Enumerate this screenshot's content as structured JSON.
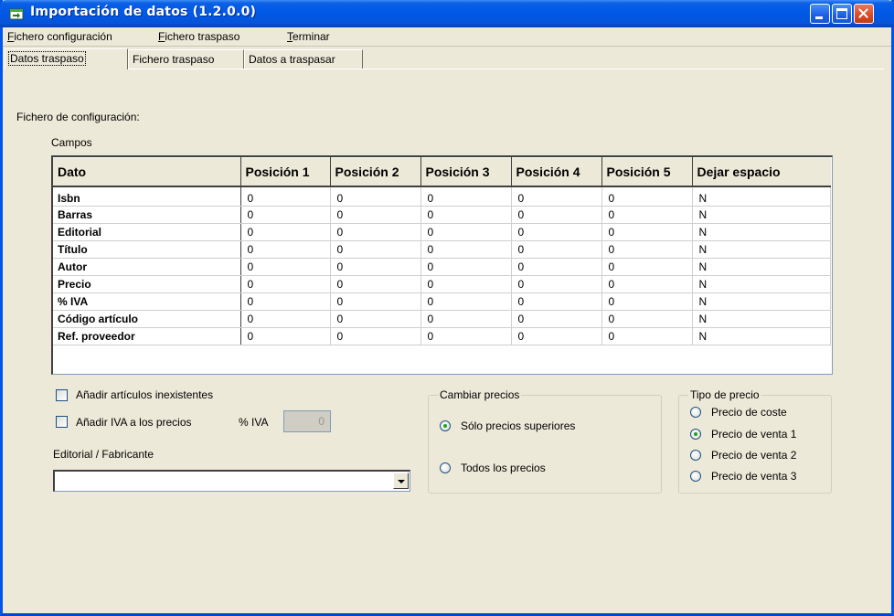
{
  "window": {
    "title": "Importación de datos (1.2.0.0)",
    "colors": {
      "title_bar": "#0058e6",
      "face": "#ece9d8",
      "close": "#d94a22"
    }
  },
  "menu": [
    {
      "label": "Fichero configuración",
      "accel": "F",
      "rest": "ichero configuración"
    },
    {
      "label": "Fichero traspaso",
      "accel": "F",
      "rest": "ichero traspaso"
    },
    {
      "label": "Terminar",
      "accel": "T",
      "rest": "erminar"
    }
  ],
  "tabs": [
    {
      "label": "Datos traspaso",
      "active": true
    },
    {
      "label": "Fichero traspaso",
      "active": false
    },
    {
      "label": "Datos a traspasar",
      "active": false
    }
  ],
  "config_label": "Fichero de configuración:",
  "campos_label": "Campos",
  "table": {
    "columns": [
      "Dato",
      "Posición 1",
      "Posición 2",
      "Posición 3",
      "Posición 4",
      "Posición 5",
      "Dejar espacio"
    ],
    "rows": [
      [
        "Isbn",
        "0",
        "0",
        "0",
        "0",
        "0",
        "N"
      ],
      [
        "Barras",
        "0",
        "0",
        "0",
        "0",
        "0",
        "N"
      ],
      [
        "Editorial",
        "0",
        "0",
        "0",
        "0",
        "0",
        "N"
      ],
      [
        "Título",
        "0",
        "0",
        "0",
        "0",
        "0",
        "N"
      ],
      [
        "Autor",
        "0",
        "0",
        "0",
        "0",
        "0",
        "N"
      ],
      [
        "Precio",
        "0",
        "0",
        "0",
        "0",
        "0",
        "N"
      ],
      [
        "% IVA",
        "0",
        "0",
        "0",
        "0",
        "0",
        "N"
      ],
      [
        "Código artículo",
        "0",
        "0",
        "0",
        "0",
        "0",
        "N"
      ],
      [
        "Ref. proveedor",
        "0",
        "0",
        "0",
        "0",
        "0",
        "N"
      ]
    ]
  },
  "options": {
    "add_missing_label": "Añadir artículos inexistentes",
    "add_missing_checked": false,
    "add_iva_label": "Añadir IVA a los precios",
    "add_iva_checked": false,
    "iva_label": "% IVA",
    "iva_value": "0"
  },
  "editorial": {
    "label": "Editorial / Fabricante",
    "value": ""
  },
  "cambiar_precios": {
    "title": "Cambiar precios",
    "options": [
      {
        "label": "Sólo precios superiores",
        "selected": true
      },
      {
        "label": "Todos los precios",
        "selected": false
      }
    ]
  },
  "tipo_precio": {
    "title": "Tipo de precio",
    "options": [
      {
        "label": "Precio de coste",
        "selected": false
      },
      {
        "label": "Precio de venta 1",
        "selected": true
      },
      {
        "label": "Precio de venta 2",
        "selected": false
      },
      {
        "label": "Precio de venta 3",
        "selected": false
      }
    ]
  },
  "icons": {
    "app": "import-data-icon",
    "minimize": "minimize-icon",
    "maximize": "maximize-icon",
    "close": "close-icon",
    "dropdown": "chevron-down-icon"
  }
}
